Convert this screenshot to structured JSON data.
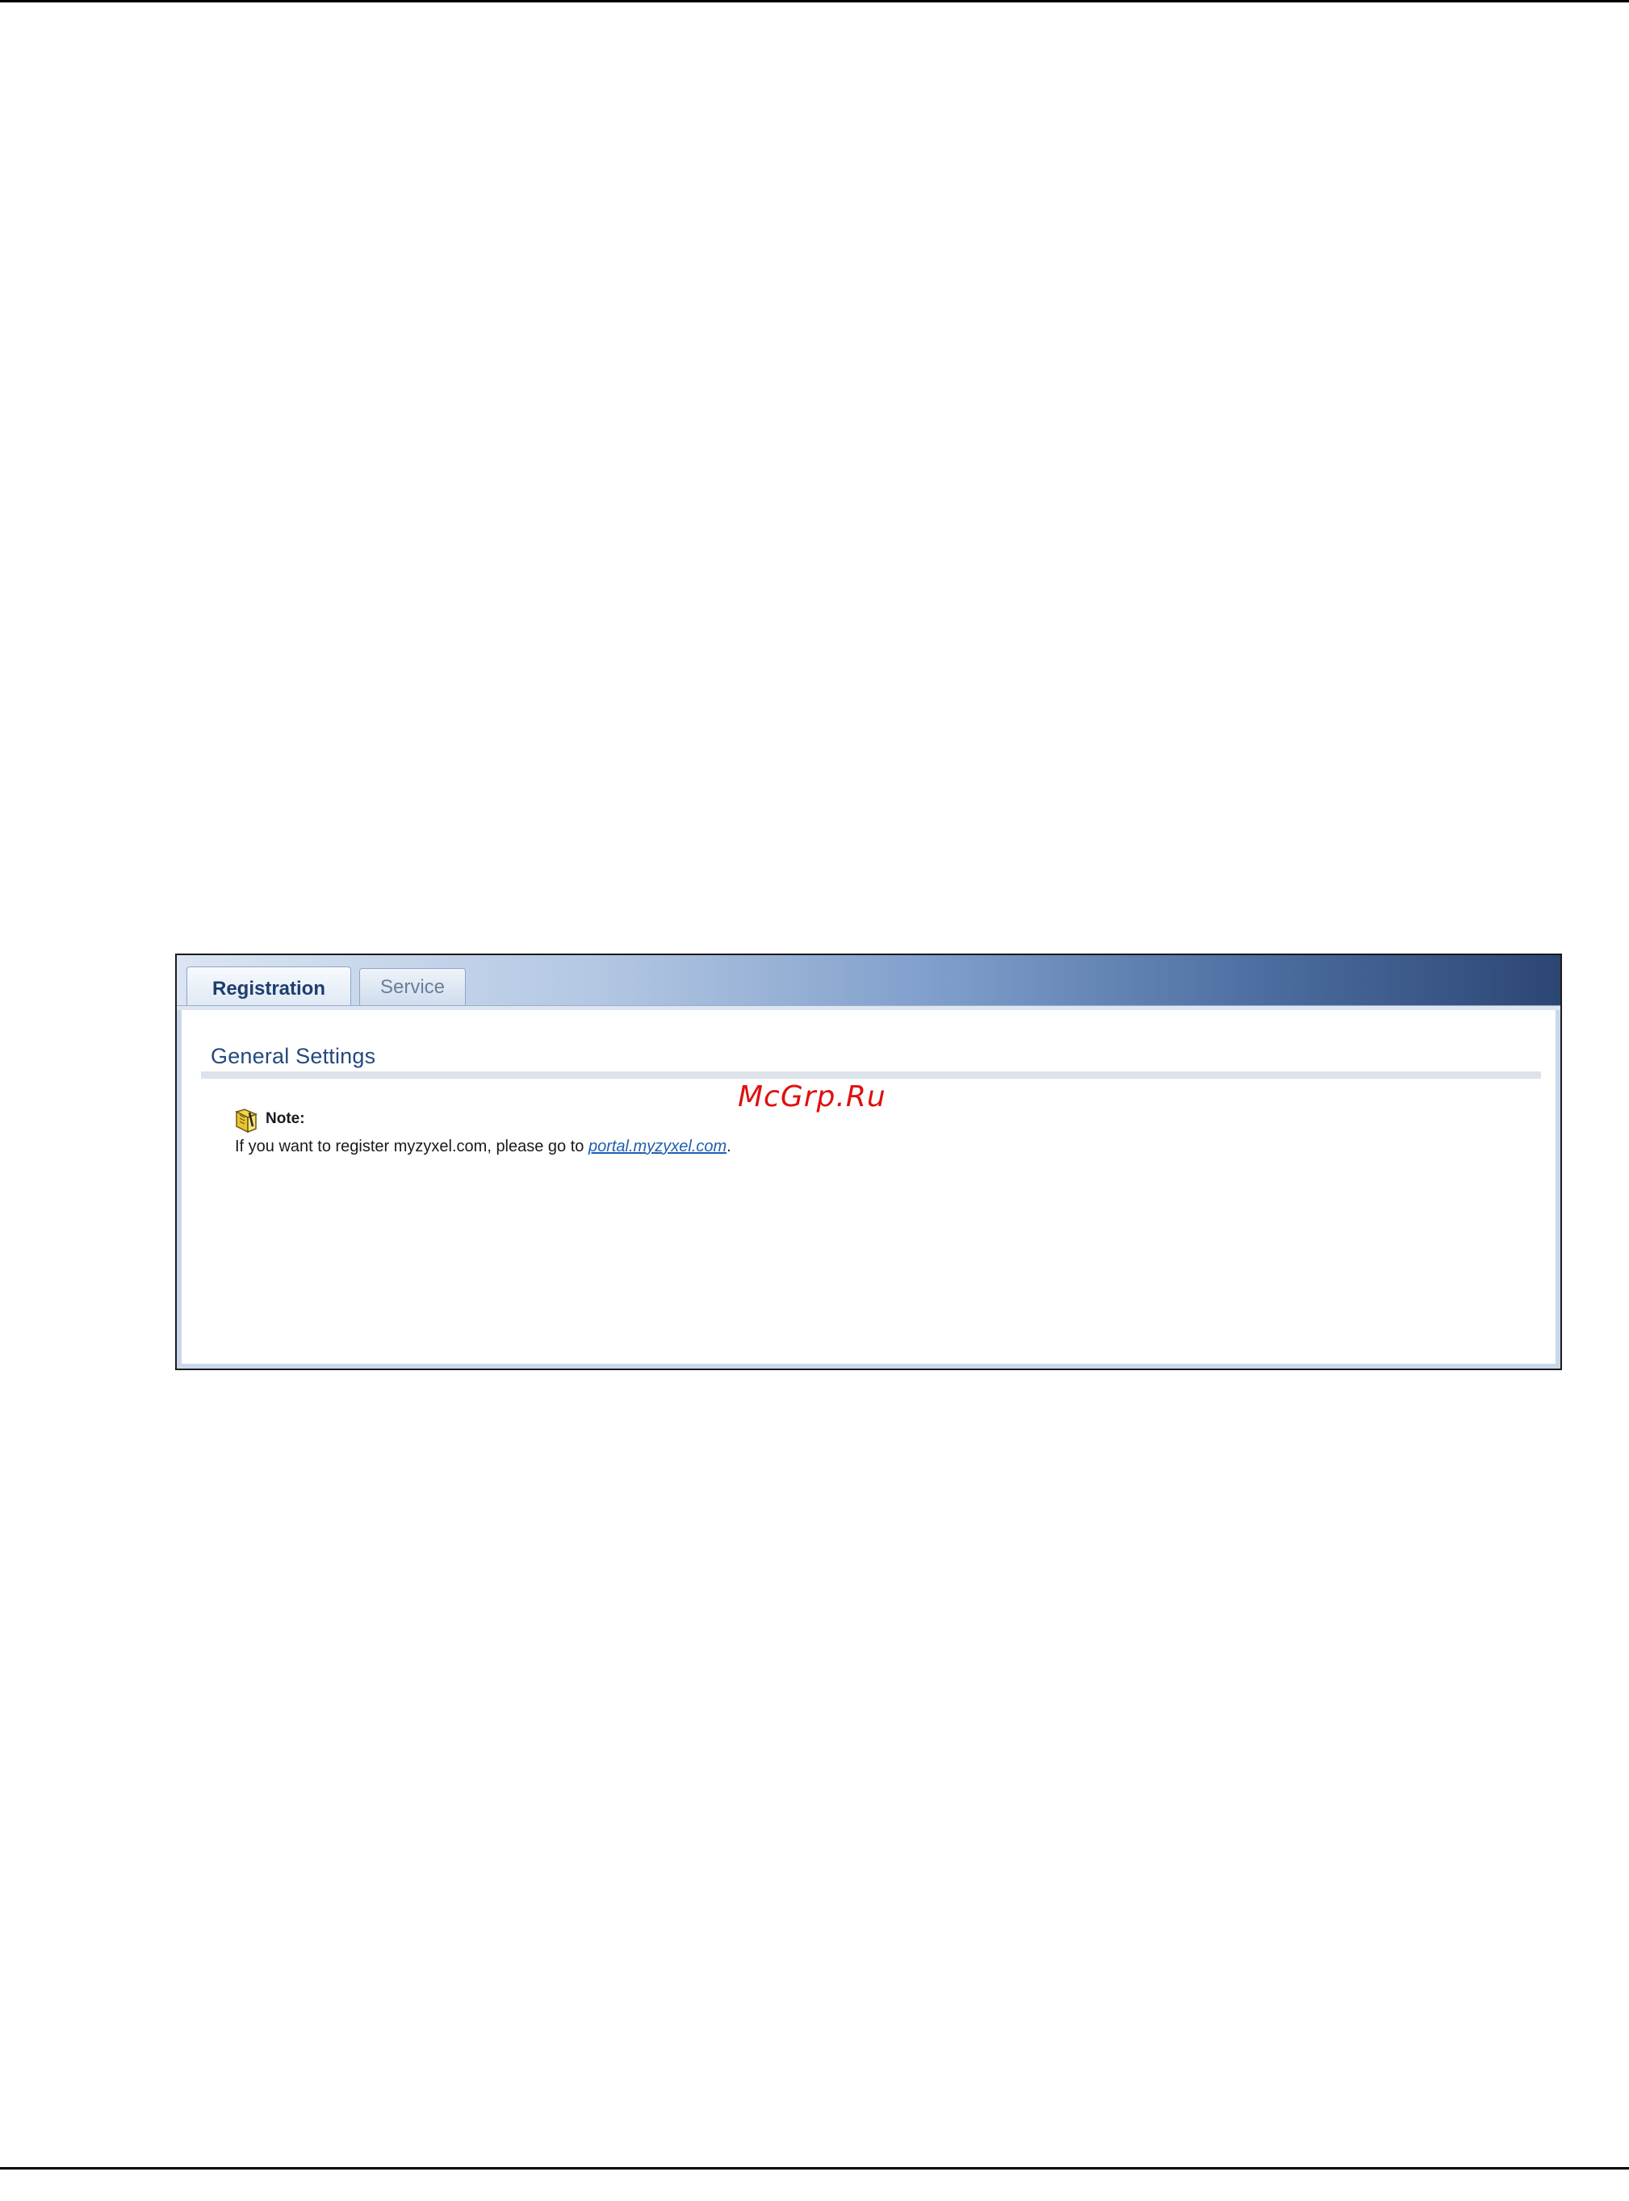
{
  "tabs": [
    {
      "label": "Registration",
      "active": true
    },
    {
      "label": "Service",
      "active": false
    }
  ],
  "section": {
    "title": "General Settings"
  },
  "note": {
    "label": "Note:",
    "text_before": "If you want to register myzyxel.com, please go to ",
    "link_text": "portal.myzyxel.com",
    "text_after": ".",
    "icon": "note-book-icon"
  },
  "watermark": "McGrp.Ru",
  "colors": {
    "accent": "#24497f",
    "link": "#1f5fb0",
    "header_dark": "#2c4674",
    "watermark": "#e01010"
  }
}
